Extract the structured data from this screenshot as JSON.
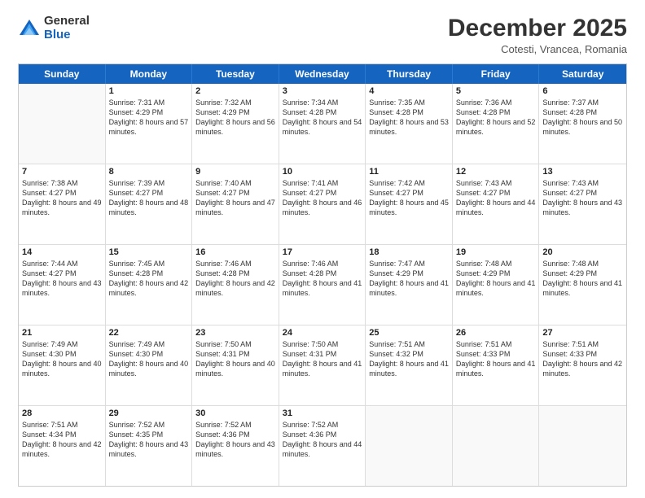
{
  "logo": {
    "general": "General",
    "blue": "Blue"
  },
  "header": {
    "month": "December 2025",
    "location": "Cotesti, Vrancea, Romania"
  },
  "weekdays": [
    "Sunday",
    "Monday",
    "Tuesday",
    "Wednesday",
    "Thursday",
    "Friday",
    "Saturday"
  ],
  "rows": [
    [
      {
        "day": "",
        "sunrise": "",
        "sunset": "",
        "daylight": ""
      },
      {
        "day": "1",
        "sunrise": "Sunrise: 7:31 AM",
        "sunset": "Sunset: 4:29 PM",
        "daylight": "Daylight: 8 hours and 57 minutes."
      },
      {
        "day": "2",
        "sunrise": "Sunrise: 7:32 AM",
        "sunset": "Sunset: 4:29 PM",
        "daylight": "Daylight: 8 hours and 56 minutes."
      },
      {
        "day": "3",
        "sunrise": "Sunrise: 7:34 AM",
        "sunset": "Sunset: 4:28 PM",
        "daylight": "Daylight: 8 hours and 54 minutes."
      },
      {
        "day": "4",
        "sunrise": "Sunrise: 7:35 AM",
        "sunset": "Sunset: 4:28 PM",
        "daylight": "Daylight: 8 hours and 53 minutes."
      },
      {
        "day": "5",
        "sunrise": "Sunrise: 7:36 AM",
        "sunset": "Sunset: 4:28 PM",
        "daylight": "Daylight: 8 hours and 52 minutes."
      },
      {
        "day": "6",
        "sunrise": "Sunrise: 7:37 AM",
        "sunset": "Sunset: 4:28 PM",
        "daylight": "Daylight: 8 hours and 50 minutes."
      }
    ],
    [
      {
        "day": "7",
        "sunrise": "Sunrise: 7:38 AM",
        "sunset": "Sunset: 4:27 PM",
        "daylight": "Daylight: 8 hours and 49 minutes."
      },
      {
        "day": "8",
        "sunrise": "Sunrise: 7:39 AM",
        "sunset": "Sunset: 4:27 PM",
        "daylight": "Daylight: 8 hours and 48 minutes."
      },
      {
        "day": "9",
        "sunrise": "Sunrise: 7:40 AM",
        "sunset": "Sunset: 4:27 PM",
        "daylight": "Daylight: 8 hours and 47 minutes."
      },
      {
        "day": "10",
        "sunrise": "Sunrise: 7:41 AM",
        "sunset": "Sunset: 4:27 PM",
        "daylight": "Daylight: 8 hours and 46 minutes."
      },
      {
        "day": "11",
        "sunrise": "Sunrise: 7:42 AM",
        "sunset": "Sunset: 4:27 PM",
        "daylight": "Daylight: 8 hours and 45 minutes."
      },
      {
        "day": "12",
        "sunrise": "Sunrise: 7:43 AM",
        "sunset": "Sunset: 4:27 PM",
        "daylight": "Daylight: 8 hours and 44 minutes."
      },
      {
        "day": "13",
        "sunrise": "Sunrise: 7:43 AM",
        "sunset": "Sunset: 4:27 PM",
        "daylight": "Daylight: 8 hours and 43 minutes."
      }
    ],
    [
      {
        "day": "14",
        "sunrise": "Sunrise: 7:44 AM",
        "sunset": "Sunset: 4:27 PM",
        "daylight": "Daylight: 8 hours and 43 minutes."
      },
      {
        "day": "15",
        "sunrise": "Sunrise: 7:45 AM",
        "sunset": "Sunset: 4:28 PM",
        "daylight": "Daylight: 8 hours and 42 minutes."
      },
      {
        "day": "16",
        "sunrise": "Sunrise: 7:46 AM",
        "sunset": "Sunset: 4:28 PM",
        "daylight": "Daylight: 8 hours and 42 minutes."
      },
      {
        "day": "17",
        "sunrise": "Sunrise: 7:46 AM",
        "sunset": "Sunset: 4:28 PM",
        "daylight": "Daylight: 8 hours and 41 minutes."
      },
      {
        "day": "18",
        "sunrise": "Sunrise: 7:47 AM",
        "sunset": "Sunset: 4:29 PM",
        "daylight": "Daylight: 8 hours and 41 minutes."
      },
      {
        "day": "19",
        "sunrise": "Sunrise: 7:48 AM",
        "sunset": "Sunset: 4:29 PM",
        "daylight": "Daylight: 8 hours and 41 minutes."
      },
      {
        "day": "20",
        "sunrise": "Sunrise: 7:48 AM",
        "sunset": "Sunset: 4:29 PM",
        "daylight": "Daylight: 8 hours and 41 minutes."
      }
    ],
    [
      {
        "day": "21",
        "sunrise": "Sunrise: 7:49 AM",
        "sunset": "Sunset: 4:30 PM",
        "daylight": "Daylight: 8 hours and 40 minutes."
      },
      {
        "day": "22",
        "sunrise": "Sunrise: 7:49 AM",
        "sunset": "Sunset: 4:30 PM",
        "daylight": "Daylight: 8 hours and 40 minutes."
      },
      {
        "day": "23",
        "sunrise": "Sunrise: 7:50 AM",
        "sunset": "Sunset: 4:31 PM",
        "daylight": "Daylight: 8 hours and 40 minutes."
      },
      {
        "day": "24",
        "sunrise": "Sunrise: 7:50 AM",
        "sunset": "Sunset: 4:31 PM",
        "daylight": "Daylight: 8 hours and 41 minutes."
      },
      {
        "day": "25",
        "sunrise": "Sunrise: 7:51 AM",
        "sunset": "Sunset: 4:32 PM",
        "daylight": "Daylight: 8 hours and 41 minutes."
      },
      {
        "day": "26",
        "sunrise": "Sunrise: 7:51 AM",
        "sunset": "Sunset: 4:33 PM",
        "daylight": "Daylight: 8 hours and 41 minutes."
      },
      {
        "day": "27",
        "sunrise": "Sunrise: 7:51 AM",
        "sunset": "Sunset: 4:33 PM",
        "daylight": "Daylight: 8 hours and 42 minutes."
      }
    ],
    [
      {
        "day": "28",
        "sunrise": "Sunrise: 7:51 AM",
        "sunset": "Sunset: 4:34 PM",
        "daylight": "Daylight: 8 hours and 42 minutes."
      },
      {
        "day": "29",
        "sunrise": "Sunrise: 7:52 AM",
        "sunset": "Sunset: 4:35 PM",
        "daylight": "Daylight: 8 hours and 43 minutes."
      },
      {
        "day": "30",
        "sunrise": "Sunrise: 7:52 AM",
        "sunset": "Sunset: 4:36 PM",
        "daylight": "Daylight: 8 hours and 43 minutes."
      },
      {
        "day": "31",
        "sunrise": "Sunrise: 7:52 AM",
        "sunset": "Sunset: 4:36 PM",
        "daylight": "Daylight: 8 hours and 44 minutes."
      },
      {
        "day": "",
        "sunrise": "",
        "sunset": "",
        "daylight": ""
      },
      {
        "day": "",
        "sunrise": "",
        "sunset": "",
        "daylight": ""
      },
      {
        "day": "",
        "sunrise": "",
        "sunset": "",
        "daylight": ""
      }
    ]
  ]
}
